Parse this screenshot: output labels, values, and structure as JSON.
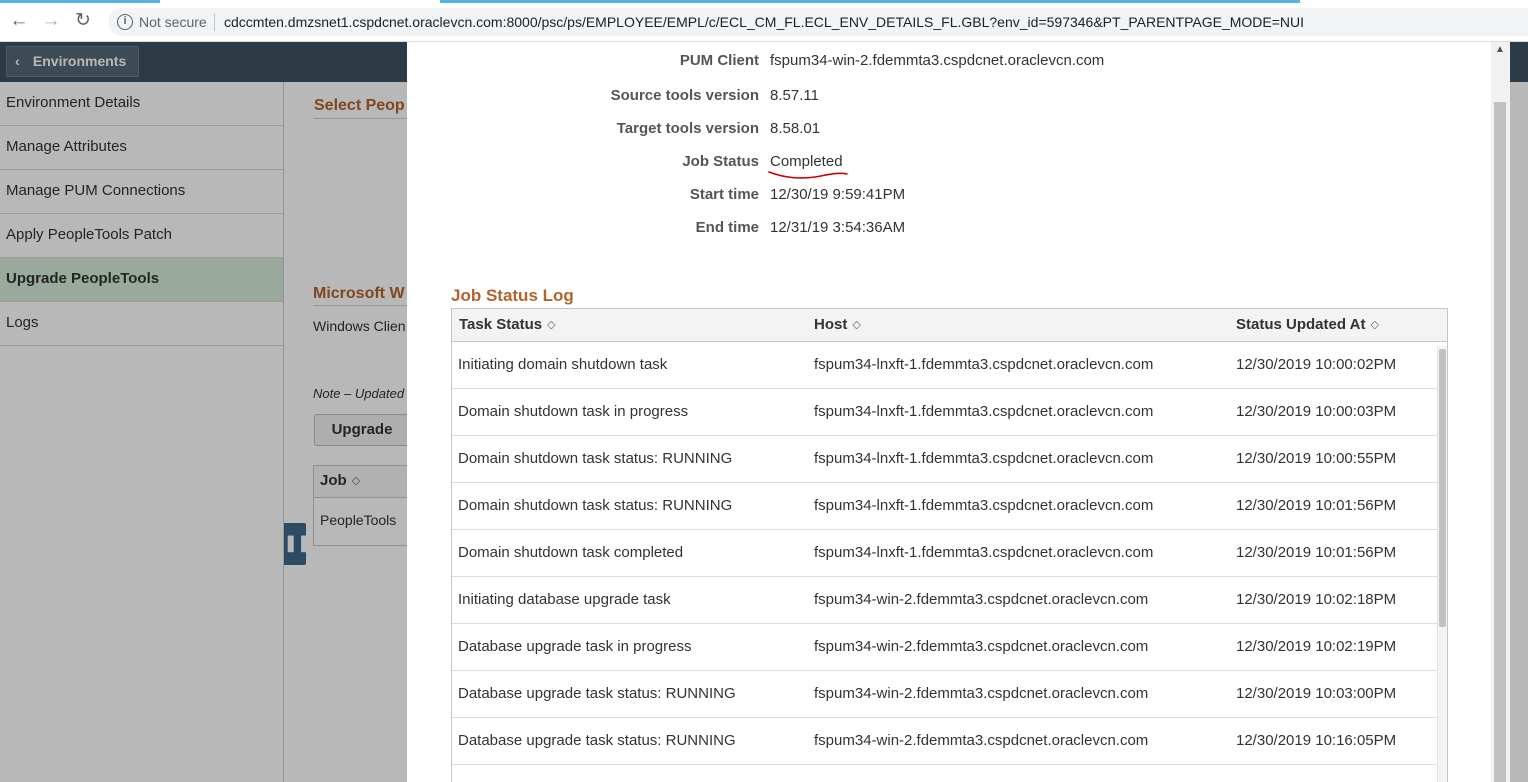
{
  "browser": {
    "security_label": "Not secure",
    "url": "cdccmten.dmzsnet1.cspdcnet.oraclevcn.com:8000/psc/ps/EMPLOYEE/EMPL/c/ECL_CM_FL.ECL_ENV_DETAILS_FL.GBL?env_id=597346&PT_PARENTPAGE_MODE=NUI"
  },
  "header": {
    "back_label": "Environments"
  },
  "sidebar": {
    "items": [
      {
        "label": "Environment Details"
      },
      {
        "label": "Manage Attributes"
      },
      {
        "label": "Manage PUM Connections"
      },
      {
        "label": "Apply PeopleTools Patch"
      },
      {
        "label": "Upgrade PeopleTools"
      },
      {
        "label": "Logs"
      }
    ]
  },
  "background": {
    "select_title": "Select Peop",
    "microsoft_title": "Microsoft W",
    "windows_client": "Windows Clien",
    "note": "Note – Updated",
    "upgrade_button": "Upgrade",
    "job_header": "Job",
    "job_cell": "PeopleTools"
  },
  "modal": {
    "details": [
      {
        "label": "PUM Client",
        "value": "fspum34-win-2.fdemmta3.cspdcnet.oraclevcn.com"
      },
      {
        "label": "Source tools version",
        "value": "8.57.11"
      },
      {
        "label": "Target tools version",
        "value": "8.58.01"
      },
      {
        "label": "Job Status",
        "value": "Completed"
      },
      {
        "label": "Start time",
        "value": "12/30/19  9:59:41PM"
      },
      {
        "label": "End time",
        "value": "12/31/19  3:54:36AM"
      }
    ],
    "annotation_color": "#cc0000",
    "log_title": "Job Status Log",
    "columns": {
      "task_status": "Task Status",
      "host": "Host",
      "updated_at": "Status Updated At"
    },
    "rows": [
      {
        "task": "Initiating domain shutdown task",
        "host": "fspum34-lnxft-1.fdemmta3.cspdcnet.oraclevcn.com",
        "time": "12/30/2019 10:00:02PM"
      },
      {
        "task": "Domain shutdown task in progress",
        "host": "fspum34-lnxft-1.fdemmta3.cspdcnet.oraclevcn.com",
        "time": "12/30/2019 10:00:03PM"
      },
      {
        "task": "Domain shutdown task status: RUNNING",
        "host": "fspum34-lnxft-1.fdemmta3.cspdcnet.oraclevcn.com",
        "time": "12/30/2019 10:00:55PM"
      },
      {
        "task": "Domain shutdown task status: RUNNING",
        "host": "fspum34-lnxft-1.fdemmta3.cspdcnet.oraclevcn.com",
        "time": "12/30/2019 10:01:56PM"
      },
      {
        "task": "Domain shutdown task completed",
        "host": "fspum34-lnxft-1.fdemmta3.cspdcnet.oraclevcn.com",
        "time": "12/30/2019 10:01:56PM"
      },
      {
        "task": "Initiating database upgrade task",
        "host": "fspum34-win-2.fdemmta3.cspdcnet.oraclevcn.com",
        "time": "12/30/2019 10:02:18PM"
      },
      {
        "task": "Database upgrade task in progress",
        "host": "fspum34-win-2.fdemmta3.cspdcnet.oraclevcn.com",
        "time": "12/30/2019 10:02:19PM"
      },
      {
        "task": "Database upgrade task status: RUNNING",
        "host": "fspum34-win-2.fdemmta3.cspdcnet.oraclevcn.com",
        "time": "12/30/2019 10:03:00PM"
      },
      {
        "task": "Database upgrade task status: RUNNING",
        "host": "fspum34-win-2.fdemmta3.cspdcnet.oraclevcn.com",
        "time": "12/30/2019 10:16:05PM"
      }
    ]
  }
}
